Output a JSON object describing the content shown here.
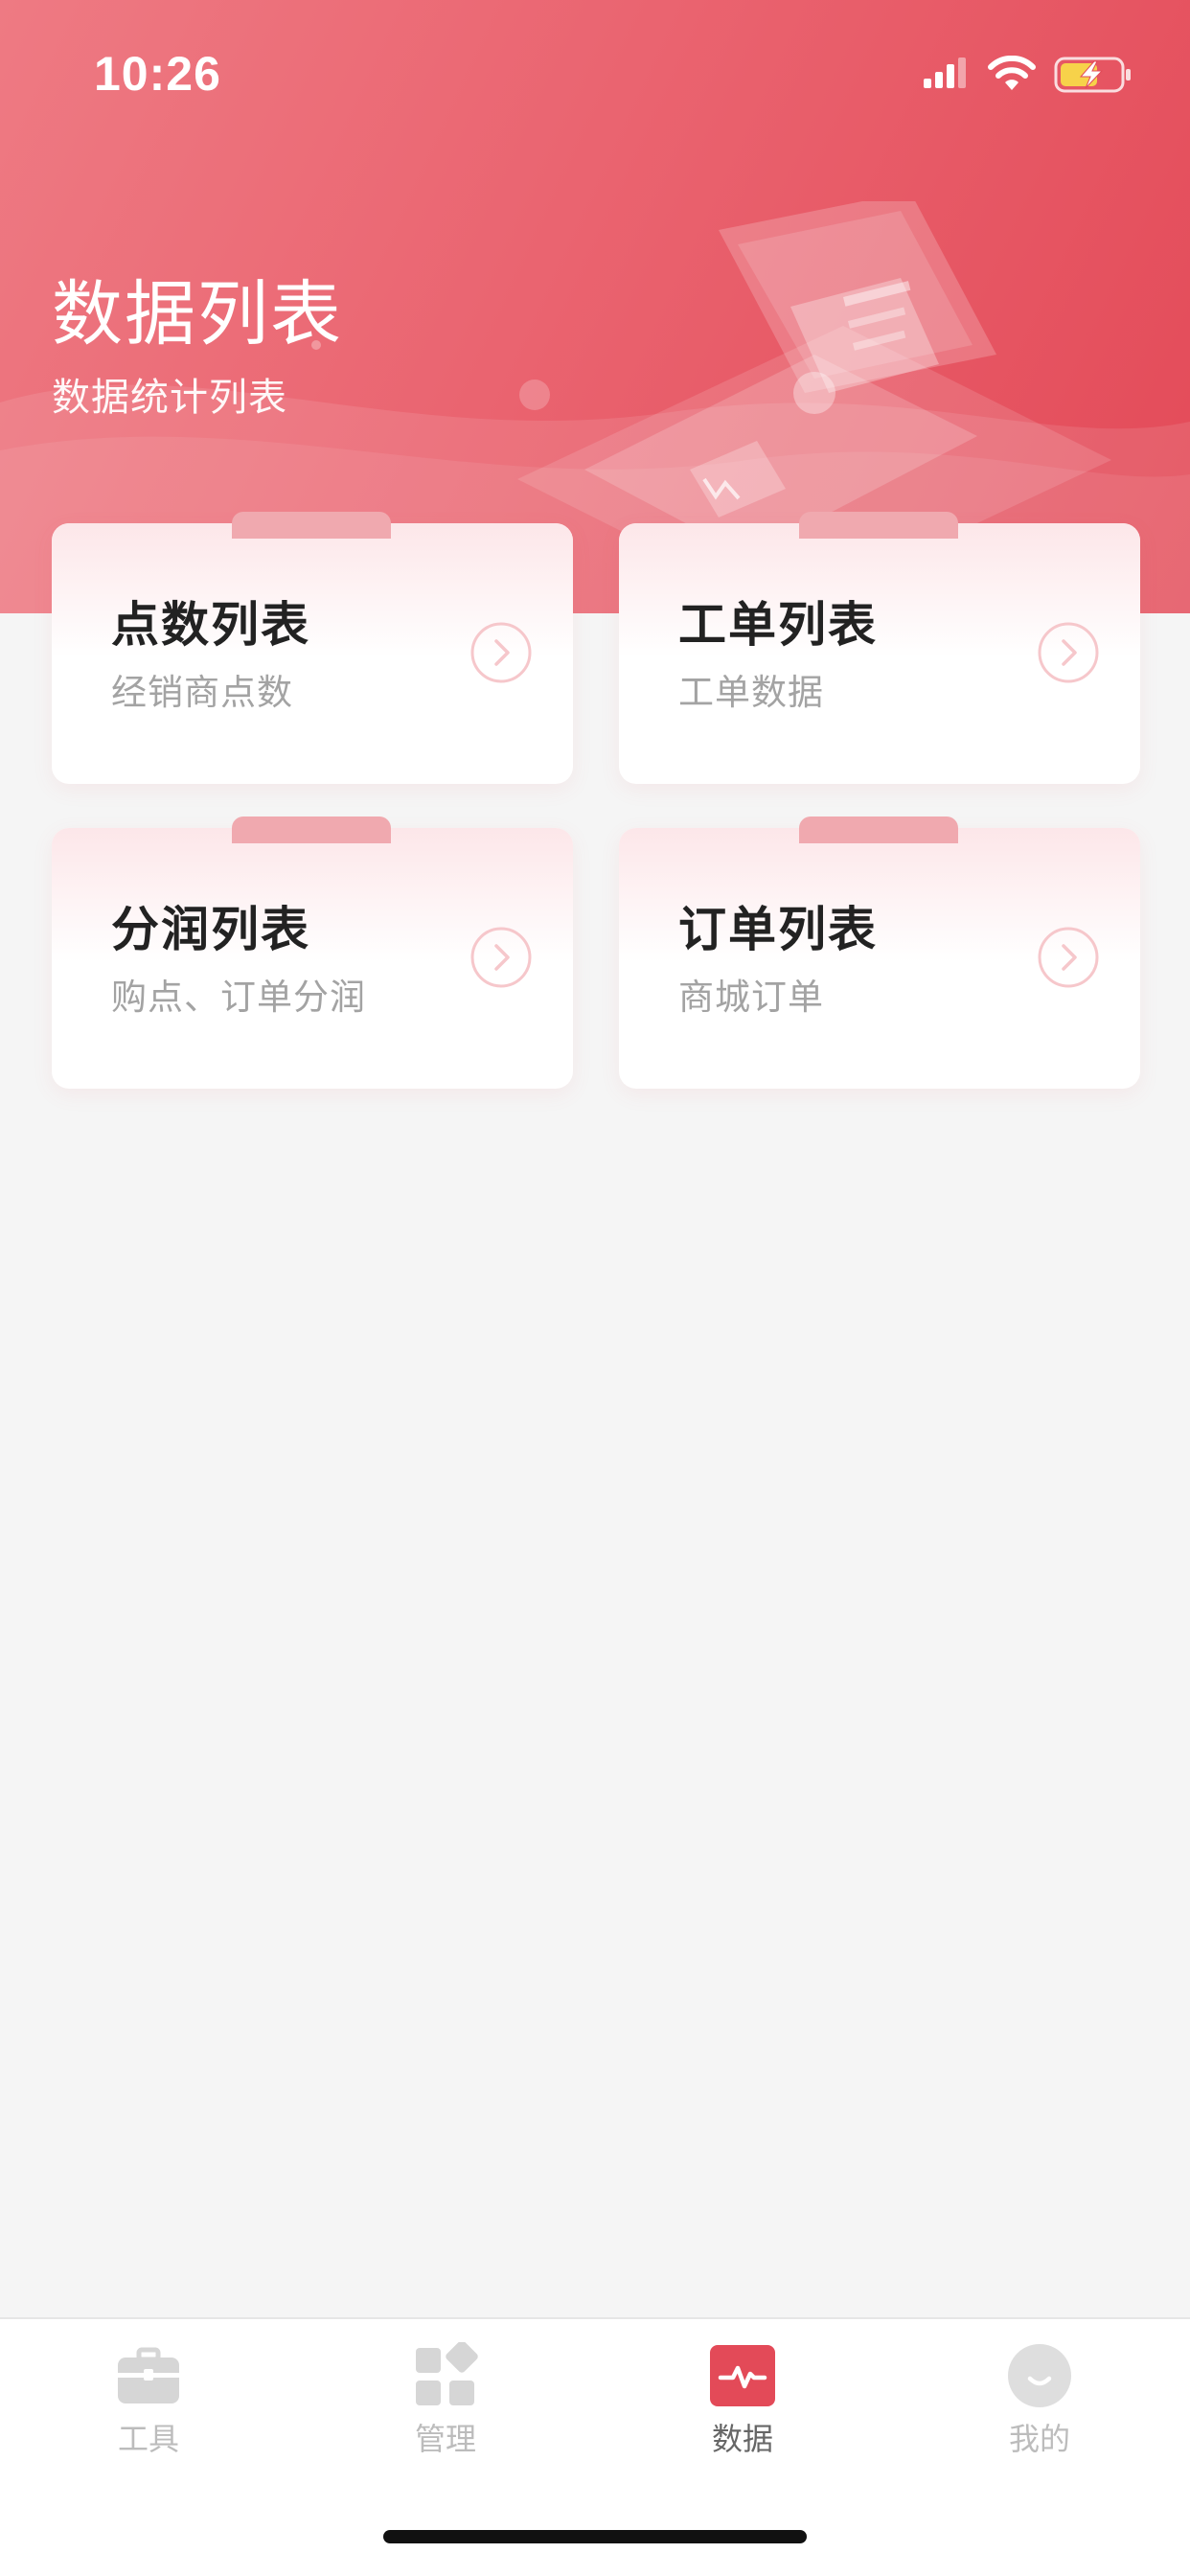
{
  "status_bar": {
    "time": "10:26"
  },
  "header": {
    "title": "数据列表",
    "subtitle": "数据统计列表"
  },
  "cards": [
    {
      "title": "点数列表",
      "desc": "经销商点数"
    },
    {
      "title": "工单列表",
      "desc": "工单数据"
    },
    {
      "title": "分润列表",
      "desc": "购点、订单分润"
    },
    {
      "title": "订单列表",
      "desc": "商城订单"
    }
  ],
  "tabbar": {
    "items": [
      {
        "label": "工具",
        "icon": "briefcase-icon",
        "active": false
      },
      {
        "label": "管理",
        "icon": "grid-icon",
        "active": false
      },
      {
        "label": "数据",
        "icon": "pulse-icon",
        "active": true
      },
      {
        "label": "我的",
        "icon": "smile-icon",
        "active": false
      }
    ]
  },
  "colors": {
    "brand": "#e34a58",
    "brand_light": "#ee7a83",
    "tab_inactive": "#bcbcbc",
    "tab_active_label": "#666666",
    "card_tab": "#f0a9af"
  }
}
